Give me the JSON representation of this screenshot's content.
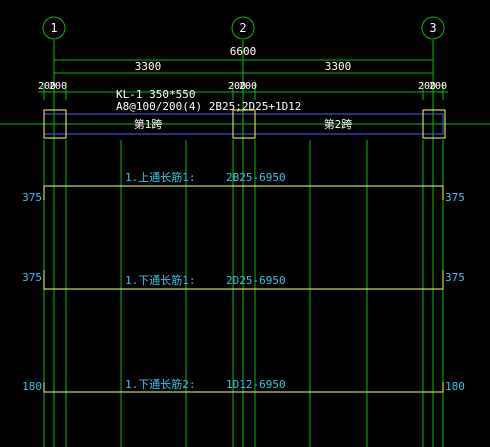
{
  "axes": [
    {
      "label": "1"
    },
    {
      "label": "2"
    },
    {
      "label": "3"
    }
  ],
  "dimensions": {
    "total": "6600",
    "spans": [
      "3300",
      "3300"
    ],
    "column_widths": [
      "200",
      "200",
      "200",
      "200",
      "200",
      "200"
    ]
  },
  "beam": {
    "name": "KL-1 350*550",
    "spec": "A8@100/200(4) 2B25;2D25+1D12",
    "span_labels": [
      "第1跨",
      "第2跨"
    ]
  },
  "rebars": [
    {
      "label": "1.上通长筋1:",
      "spec": "2B25-6950",
      "left_dim": "375",
      "right_dim": "375"
    },
    {
      "label": "1.下通长筋1:",
      "spec": "2D25-6950",
      "left_dim": "375",
      "right_dim": "375"
    },
    {
      "label": "1.下通长筋2:",
      "spec": "1D12-6950",
      "left_dim": "180",
      "right_dim": "180"
    }
  ],
  "colors": {
    "background": "#000000",
    "grid": "#00c000",
    "column": "#ffff66",
    "beam": "#4a5cff",
    "text_white": "#ffffff",
    "text_cyan": "#34c6e6"
  }
}
